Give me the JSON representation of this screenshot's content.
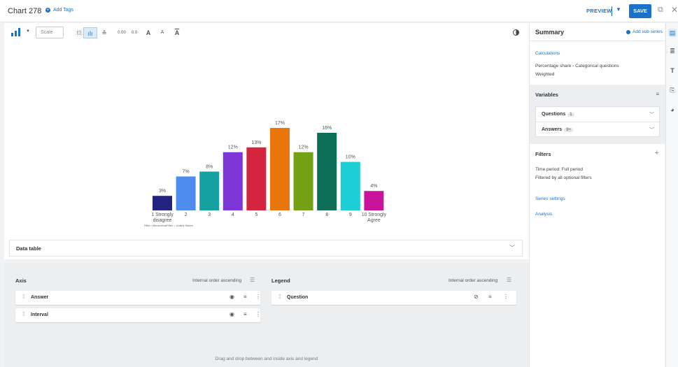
{
  "header": {
    "title": "Chart 278",
    "add_tags": "Add Tags",
    "preview": "PREVIEW",
    "save": "SAVE"
  },
  "toolbar": {
    "scale_placeholder": "Scale",
    "decimals_up": "0.00",
    "decimals_down": "0.0",
    "font_up": "A",
    "font_down": "A",
    "text_style": "A"
  },
  "chart_data": {
    "type": "bar",
    "categories": [
      "1 Strongly disagree",
      "2",
      "3",
      "4",
      "5",
      "6",
      "7",
      "8",
      "9",
      "10 Strongly Agree"
    ],
    "values": [
      3,
      7,
      8,
      12,
      13,
      17,
      12,
      16,
      10,
      4
    ],
    "value_labels": [
      "3%",
      "7%",
      "8%",
      "12%",
      "13%",
      "17%",
      "12%",
      "16%",
      "10%",
      "4%"
    ],
    "colors": [
      "#24237f",
      "#4e8cf0",
      "#14a1a0",
      "#7c35d6",
      "#d4243e",
      "#e9760a",
      "#73a015",
      "#0c6e57",
      "#1ccfd6",
      "#c8149b"
    ],
    "ylim": [
      0,
      17
    ],
    "filter_note": "Filter: HierarchicalFilter = United States"
  },
  "data_table": {
    "label": "Data table"
  },
  "axis": {
    "title": "Axis",
    "sort": "Internal order ascending",
    "items": [
      {
        "name": "Answer"
      },
      {
        "name": "Interval"
      }
    ]
  },
  "legend": {
    "title": "Legend",
    "sort": "Internal order ascending",
    "items": [
      {
        "name": "Question"
      }
    ]
  },
  "dnd_hint": "Drag and drop between and inside axis and legend",
  "panel": {
    "title": "Summary",
    "add_sub_series": "Add sub series",
    "calculations": "Calculations",
    "calc_line1": "Percentage share - Categorical questions",
    "calc_line2": "Weighted",
    "variables_title": "Variables",
    "questions": {
      "label": "Questions",
      "badge": "1"
    },
    "answers": {
      "label": "Answers",
      "badge": "9+"
    },
    "filters_title": "Filters",
    "filter_line1": "Time period: Full period",
    "filter_line2": "Filtered by all optional filters",
    "series_settings": "Series settings",
    "analysis": "Analysis"
  }
}
